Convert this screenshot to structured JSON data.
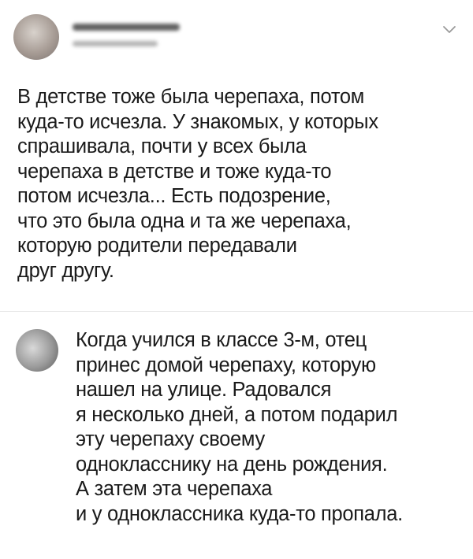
{
  "main_post": {
    "lines": [
      "В детстве тоже была черепаха, потом",
      "куда-то исчезла. У знакомых, у которых",
      "спрашивала, почти у всех была",
      "черепаха в детстве и тоже куда-то",
      "потом исчезла... Есть подозрение,",
      "что это была одна и та же черепаха,",
      "которую родители передавали",
      "друг другу."
    ]
  },
  "reply": {
    "lines": [
      "Когда учился в классе 3-м, отец",
      "принес домой черепаху, которую",
      "нашел на улице. Радовался",
      "я несколько дней, а потом подарил",
      "эту черепаху своему",
      "однокласснику на день рождения.",
      "А затем эта черепаха",
      "и у одноклассника куда-то пропала."
    ]
  },
  "icons": {
    "menu": "chevron-down-icon"
  }
}
